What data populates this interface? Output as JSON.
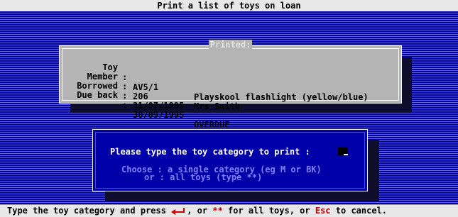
{
  "window": {
    "title": "Print a list of toys on loan"
  },
  "printed_panel": {
    "caption": "Printed:",
    "rows": [
      {
        "label": "Toy",
        "code": "AV5/1",
        "desc": "Playskool flashlight (yellow/blue)"
      },
      {
        "label": "Member",
        "code": "206",
        "desc": "Mrs Smith"
      },
      {
        "label": "Borrowed",
        "code": "31/07/1995",
        "desc": ""
      },
      {
        "label": "Due back",
        "code": "30/09/1995",
        "desc": "OVERDUE"
      }
    ]
  },
  "prompt": {
    "question": "Please type the toy category to print :",
    "choose_line": "Choose : a single category (eg M or BK)",
    "or_line": "or : all toys (type **)"
  },
  "status_bar": {
    "part1": "Type the toy category and press",
    "part2": ", or",
    "stars": "**",
    "part3": "for all toys, or",
    "esc": "Esc",
    "part4": "to cancel."
  },
  "colors": {
    "background_blue": "#0000a8",
    "accent_red": "#c80000",
    "panel_grey": "#b4b4b4",
    "hint_blue": "#8080ff"
  }
}
